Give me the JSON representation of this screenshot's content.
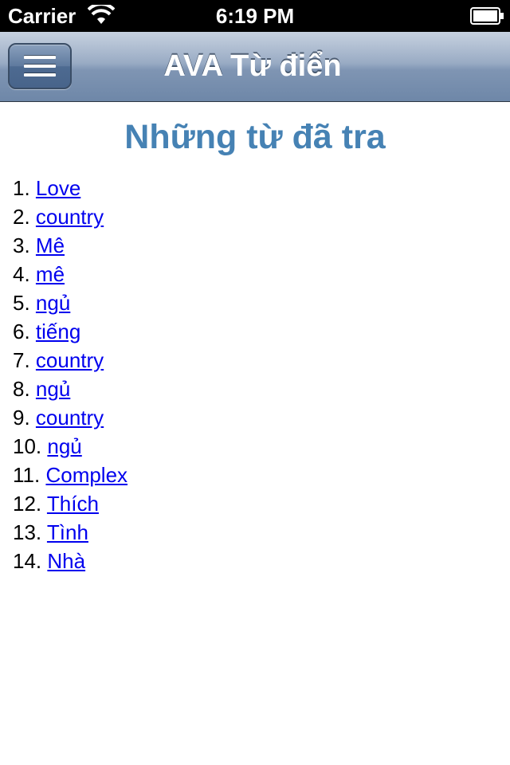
{
  "status_bar": {
    "carrier": "Carrier",
    "time": "6:19 PM",
    "wifi_icon": "wifi-icon",
    "battery_icon": "battery-icon"
  },
  "nav_bar": {
    "title": "AVA Từ điển",
    "menu_icon": "hamburger-menu-icon",
    "color_top": "#c7d2e0",
    "color_bottom": "#6e87a8"
  },
  "page": {
    "title": "Những từ đã tra",
    "title_color": "#4682b4",
    "link_color": "#0000ee"
  },
  "history": [
    {
      "index": "1.",
      "word": "Love"
    },
    {
      "index": "2.",
      "word": "country"
    },
    {
      "index": "3.",
      "word": "Mê"
    },
    {
      "index": "4.",
      "word": "mê"
    },
    {
      "index": "5.",
      "word": "ngủ"
    },
    {
      "index": "6.",
      "word": "tiếng"
    },
    {
      "index": "7.",
      "word": "country"
    },
    {
      "index": "8.",
      "word": "ngủ"
    },
    {
      "index": "9.",
      "word": "country"
    },
    {
      "index": "10.",
      "word": "ngủ"
    },
    {
      "index": "11.",
      "word": "Complex"
    },
    {
      "index": "12.",
      "word": "Thích"
    },
    {
      "index": "13.",
      "word": "Tình"
    },
    {
      "index": "14.",
      "word": "Nhà"
    }
  ]
}
